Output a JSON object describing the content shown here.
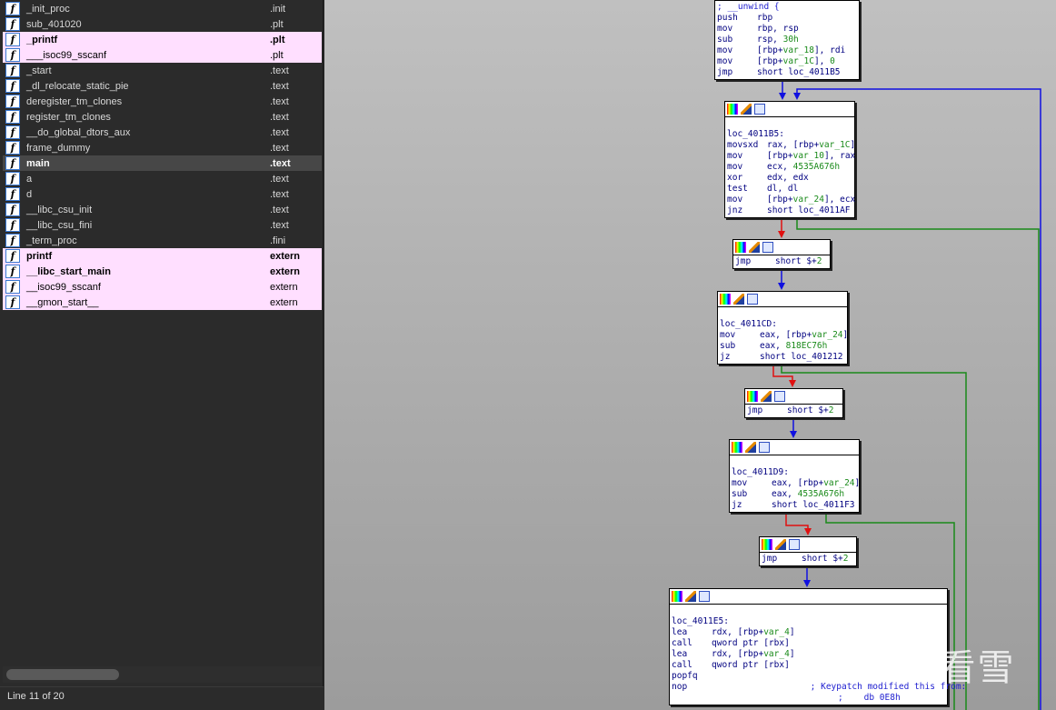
{
  "functions": [
    {
      "name": "_init_proc",
      "segment": ".init",
      "style": ""
    },
    {
      "name": "sub_401020",
      "segment": ".plt",
      "style": ""
    },
    {
      "name": "_printf",
      "segment": ".plt",
      "style": "pink bold"
    },
    {
      "name": "___isoc99_sscanf",
      "segment": ".plt",
      "style": "pink"
    },
    {
      "name": "_start",
      "segment": ".text",
      "style": ""
    },
    {
      "name": "_dl_relocate_static_pie",
      "segment": ".text",
      "style": ""
    },
    {
      "name": "deregister_tm_clones",
      "segment": ".text",
      "style": ""
    },
    {
      "name": "register_tm_clones",
      "segment": ".text",
      "style": ""
    },
    {
      "name": "__do_global_dtors_aux",
      "segment": ".text",
      "style": ""
    },
    {
      "name": "frame_dummy",
      "segment": ".text",
      "style": ""
    },
    {
      "name": "main",
      "segment": ".text",
      "style": "sel"
    },
    {
      "name": "a",
      "segment": ".text",
      "style": ""
    },
    {
      "name": "d",
      "segment": ".text",
      "style": ""
    },
    {
      "name": "__libc_csu_init",
      "segment": ".text",
      "style": ""
    },
    {
      "name": "__libc_csu_fini",
      "segment": ".text",
      "style": ""
    },
    {
      "name": "_term_proc",
      "segment": ".fini",
      "style": ""
    },
    {
      "name": "printf",
      "segment": "extern",
      "style": "pink bold"
    },
    {
      "name": "__libc_start_main",
      "segment": "extern",
      "style": "pink bold"
    },
    {
      "name": "__isoc99_sscanf",
      "segment": "extern",
      "style": "pink"
    },
    {
      "name": "__gmon_start__",
      "segment": "extern",
      "style": "pink"
    }
  ],
  "status": "Line 11 of 20",
  "watermark": "看雪",
  "blocks": [
    {
      "id": "entry",
      "header": false,
      "lines": [
        [
          [
            "; __unwind {",
            "cm"
          ]
        ],
        [
          "push",
          "rbp"
        ],
        [
          "mov",
          "rbp, rsp"
        ],
        [
          "sub",
          "rsp, ",
          [
            "30h",
            "v"
          ]
        ],
        [
          "mov",
          "[rbp+",
          [
            "var_18",
            "v"
          ],
          "], rdi"
        ],
        [
          "mov",
          "[rbp+",
          [
            "var_1C",
            "v"
          ],
          "], ",
          [
            "0",
            "v"
          ]
        ],
        [
          "jmp",
          "short loc_4011B5"
        ]
      ]
    },
    {
      "id": "loc_4011B5",
      "header": true,
      "lines": [
        [
          [
            " ",
            "lb"
          ]
        ],
        [
          [
            "loc_4011B5:",
            "lb"
          ]
        ],
        [
          "movsxd",
          "rax, [rbp+",
          [
            "var_1C",
            "v"
          ],
          "]"
        ],
        [
          "mov",
          "[rbp+",
          [
            "var_10",
            "v"
          ],
          "], rax"
        ],
        [
          "mov",
          "ecx, ",
          [
            "4535A676h",
            "v"
          ]
        ],
        [
          "xor",
          "edx, edx"
        ],
        [
          "test",
          "dl, dl"
        ],
        [
          "mov",
          "[rbp+",
          [
            "var_24",
            "v"
          ],
          "], ecx"
        ],
        [
          "jnz",
          "short loc_4011AF"
        ]
      ]
    },
    {
      "id": "jmp1",
      "header": true,
      "lines": [
        [
          "jmp",
          "short $+",
          [
            "2",
            "v"
          ]
        ]
      ]
    },
    {
      "id": "loc_4011CD",
      "header": true,
      "lines": [
        [
          [
            " ",
            "lb"
          ]
        ],
        [
          [
            "loc_4011CD:",
            "lb"
          ]
        ],
        [
          "mov",
          "eax, [rbp+",
          [
            "var_24",
            "v"
          ],
          "]"
        ],
        [
          "sub",
          "eax, ",
          [
            "818EC76h",
            "v"
          ]
        ],
        [
          "jz",
          "short loc_401212"
        ]
      ]
    },
    {
      "id": "jmp2",
      "header": true,
      "lines": [
        [
          "jmp",
          "short $+",
          [
            "2",
            "v"
          ]
        ]
      ]
    },
    {
      "id": "loc_4011D9",
      "header": true,
      "lines": [
        [
          [
            " ",
            "lb"
          ]
        ],
        [
          [
            "loc_4011D9:",
            "lb"
          ]
        ],
        [
          "mov",
          "eax, [rbp+",
          [
            "var_24",
            "v"
          ],
          "]"
        ],
        [
          "sub",
          "eax, ",
          [
            "4535A676h",
            "v"
          ]
        ],
        [
          "jz",
          "short loc_4011F3"
        ]
      ]
    },
    {
      "id": "jmp3",
      "header": true,
      "lines": [
        [
          "jmp",
          "short $+",
          [
            "2",
            "v"
          ]
        ]
      ]
    },
    {
      "id": "loc_4011E5",
      "header": true,
      "lines": [
        [
          [
            " ",
            "lb"
          ]
        ],
        [
          [
            "loc_4011E5:",
            "lb"
          ]
        ],
        [
          "lea",
          "rdx, [rbp+",
          [
            "var_4",
            "v"
          ],
          "]"
        ],
        [
          "call",
          "qword ptr [rbx]"
        ],
        [
          "lea",
          "rdx, [rbp+",
          [
            "var_4",
            "v"
          ],
          "]"
        ],
        [
          "call",
          "qword ptr [rbx]"
        ],
        [
          "popfq",
          ""
        ],
        [
          "nop",
          [
            "                   ; Keypatch modified this from:",
            "cm"
          ]
        ],
        [
          [
            "                                ;    db 0E8h",
            "cm"
          ]
        ]
      ]
    }
  ]
}
